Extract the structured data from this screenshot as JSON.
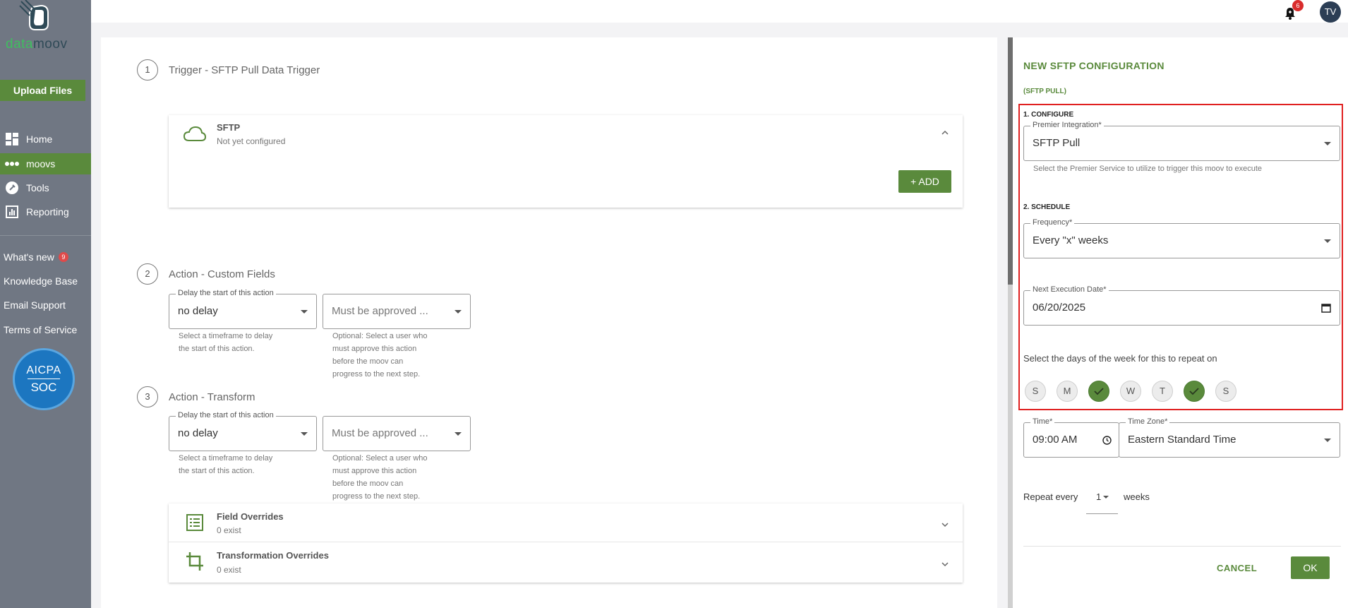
{
  "sidebar": {
    "logo": {
      "text_a": "data",
      "text_b": "moov"
    },
    "upload_label": "Upload Files",
    "nav": [
      {
        "label": "Home",
        "icon": "dashboard-icon"
      },
      {
        "label": "moovs",
        "icon": "dots-icon",
        "active": true
      },
      {
        "label": "Tools",
        "icon": "wrench-icon"
      },
      {
        "label": "Reporting",
        "icon": "chart-icon"
      }
    ],
    "links": {
      "whats_new": "What's new",
      "whats_new_badge": "9",
      "knowledge_base": "Knowledge Base",
      "email_support": "Email Support",
      "terms": "Terms of Service"
    },
    "aicpa": {
      "line1": "AICPA",
      "line2": "SOC"
    }
  },
  "topbar": {
    "notifications": "6",
    "avatar": "TV"
  },
  "workflow": {
    "step1": {
      "number": "1",
      "title": "Trigger - SFTP Pull Data Trigger",
      "card_title": "SFTP",
      "card_sub": "Not yet configured",
      "add_label": "+ ADD"
    },
    "step2": {
      "number": "2",
      "title": "Action - Custom Fields",
      "delay_label": "Delay the start of this action",
      "delay_value": "no delay",
      "delay_help": [
        "Select a timeframe to delay",
        "the start of this action."
      ],
      "approve_placeholder": "Must be approved ...",
      "approve_help": [
        "Optional: Select a user who",
        "must approve this action",
        "before the moov can",
        "progress to the next step."
      ]
    },
    "step3": {
      "number": "3",
      "title": "Action - Transform",
      "delay_label": "Delay the start of this action",
      "delay_value": "no delay",
      "delay_help": [
        "Select a timeframe to delay",
        "the start of this action."
      ],
      "approve_placeholder": "Must be approved ...",
      "approve_help": [
        "Optional: Select a user who",
        "must approve this action",
        "before the moov can",
        "progress to the next step."
      ],
      "overrides": [
        {
          "title": "Field Overrides",
          "sub": "0 exist"
        },
        {
          "title": "Transformation Overrides",
          "sub": "0 exist"
        }
      ]
    }
  },
  "panel": {
    "title": "NEW SFTP CONFIGURATION",
    "subtitle": "(SFTP PULL)",
    "configure": {
      "heading": "1. CONFIGURE",
      "label": "Premier Integration*",
      "value": "SFTP Pull",
      "help": "Select the Premier Service to utilize to trigger this moov to execute"
    },
    "schedule": {
      "heading": "2. SCHEDULE",
      "frequency_label": "Frequency*",
      "frequency_value": "Every \"x\" weeks",
      "date_label": "Next Execution Date*",
      "date_value": "06/20/2025",
      "days_prompt": "Select the days of the week for this to repeat on",
      "days": [
        {
          "label": "S",
          "selected": false
        },
        {
          "label": "M",
          "selected": false
        },
        {
          "label": "T",
          "selected": true
        },
        {
          "label": "W",
          "selected": false
        },
        {
          "label": "T",
          "selected": false
        },
        {
          "label": "F",
          "selected": true
        },
        {
          "label": "S",
          "selected": false
        }
      ],
      "time_label": "Time*",
      "time_value": "09:00 AM",
      "tz_label": "Time Zone*",
      "tz_value": "Eastern Standard Time",
      "repeat_prefix": "Repeat every",
      "repeat_value": "1",
      "repeat_suffix": "weeks"
    },
    "cancel_label": "CANCEL",
    "ok_label": "OK"
  }
}
